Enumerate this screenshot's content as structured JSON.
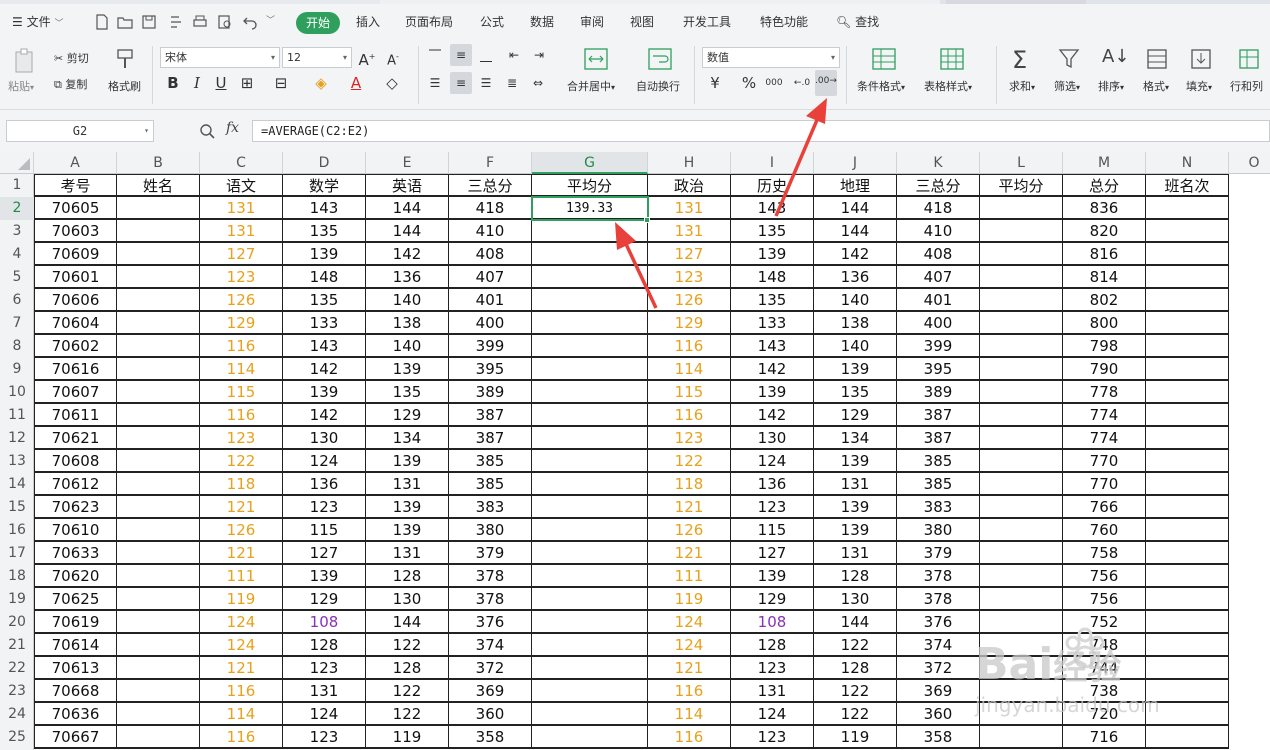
{
  "menubar": {
    "file_label": "文件",
    "tabs": [
      "开始",
      "插入",
      "页面布局",
      "公式",
      "数据",
      "审阅",
      "视图",
      "开发工具",
      "特色功能"
    ],
    "active_tab": "开始",
    "search_label": "查找"
  },
  "ribbon": {
    "paste": "粘贴",
    "cut": "剪切",
    "copy": "复制",
    "format_painter": "格式刷",
    "font_name": "宋体",
    "font_size": "12",
    "bold": "B",
    "italic": "I",
    "underline": "U",
    "merge_center": "合并居中",
    "wrap_text": "自动换行",
    "number_format": "数值",
    "percent": "%",
    "thousands": "000",
    "conditional_format": "条件格式",
    "table_style": "表格样式",
    "sum": "求和",
    "filter": "筛选",
    "sort": "排序",
    "format": "格式",
    "fill": "填充",
    "row_col": "行和列"
  },
  "formula_bar": {
    "name_box": "G2",
    "fx": "fx",
    "formula": "=AVERAGE(C2:E2)"
  },
  "grid": {
    "columns": [
      "A",
      "B",
      "C",
      "D",
      "E",
      "F",
      "G",
      "H",
      "I",
      "J",
      "K",
      "L",
      "M",
      "N",
      "O"
    ],
    "active_column": "G",
    "active_row": "2",
    "row_numbers": [
      "1",
      "2",
      "3",
      "4",
      "5",
      "6",
      "7",
      "8",
      "9",
      "10",
      "11",
      "12",
      "13",
      "14",
      "15",
      "16",
      "17",
      "18",
      "19",
      "20",
      "21",
      "22",
      "23",
      "24",
      "25"
    ],
    "headers": [
      "考号",
      "姓名",
      "语文",
      "数学",
      "英语",
      "三总分",
      "平均分",
      "政治",
      "历史",
      "地理",
      "三总分",
      "平均分",
      "总分",
      "班名次"
    ],
    "rows": [
      [
        "70605",
        "",
        "131",
        "143",
        "144",
        "418",
        "139.33",
        "131",
        "143",
        "144",
        "418",
        "",
        "836",
        ""
      ],
      [
        "70603",
        "",
        "131",
        "135",
        "144",
        "410",
        "",
        "131",
        "135",
        "144",
        "410",
        "",
        "820",
        ""
      ],
      [
        "70609",
        "",
        "127",
        "139",
        "142",
        "408",
        "",
        "127",
        "139",
        "142",
        "408",
        "",
        "816",
        ""
      ],
      [
        "70601",
        "",
        "123",
        "148",
        "136",
        "407",
        "",
        "123",
        "148",
        "136",
        "407",
        "",
        "814",
        ""
      ],
      [
        "70606",
        "",
        "126",
        "135",
        "140",
        "401",
        "",
        "126",
        "135",
        "140",
        "401",
        "",
        "802",
        ""
      ],
      [
        "70604",
        "",
        "129",
        "133",
        "138",
        "400",
        "",
        "129",
        "133",
        "138",
        "400",
        "",
        "800",
        ""
      ],
      [
        "70602",
        "",
        "116",
        "143",
        "140",
        "399",
        "",
        "116",
        "143",
        "140",
        "399",
        "",
        "798",
        ""
      ],
      [
        "70616",
        "",
        "114",
        "142",
        "139",
        "395",
        "",
        "114",
        "142",
        "139",
        "395",
        "",
        "790",
        ""
      ],
      [
        "70607",
        "",
        "115",
        "139",
        "135",
        "389",
        "",
        "115",
        "139",
        "135",
        "389",
        "",
        "778",
        ""
      ],
      [
        "70611",
        "",
        "116",
        "142",
        "129",
        "387",
        "",
        "116",
        "142",
        "129",
        "387",
        "",
        "774",
        ""
      ],
      [
        "70621",
        "",
        "123",
        "130",
        "134",
        "387",
        "",
        "123",
        "130",
        "134",
        "387",
        "",
        "774",
        ""
      ],
      [
        "70608",
        "",
        "122",
        "124",
        "139",
        "385",
        "",
        "122",
        "124",
        "139",
        "385",
        "",
        "770",
        ""
      ],
      [
        "70612",
        "",
        "118",
        "136",
        "131",
        "385",
        "",
        "118",
        "136",
        "131",
        "385",
        "",
        "770",
        ""
      ],
      [
        "70623",
        "",
        "121",
        "123",
        "139",
        "383",
        "",
        "121",
        "123",
        "139",
        "383",
        "",
        "766",
        ""
      ],
      [
        "70610",
        "",
        "126",
        "115",
        "139",
        "380",
        "",
        "126",
        "115",
        "139",
        "380",
        "",
        "760",
        ""
      ],
      [
        "70633",
        "",
        "121",
        "127",
        "131",
        "379",
        "",
        "121",
        "127",
        "131",
        "379",
        "",
        "758",
        ""
      ],
      [
        "70620",
        "",
        "111",
        "139",
        "128",
        "378",
        "",
        "111",
        "139",
        "128",
        "378",
        "",
        "756",
        ""
      ],
      [
        "70625",
        "",
        "119",
        "129",
        "130",
        "378",
        "",
        "119",
        "129",
        "130",
        "378",
        "",
        "756",
        ""
      ],
      [
        "70619",
        "",
        "124",
        "108",
        "144",
        "376",
        "",
        "124",
        "108",
        "144",
        "376",
        "",
        "752",
        ""
      ],
      [
        "70614",
        "",
        "124",
        "128",
        "122",
        "374",
        "",
        "124",
        "128",
        "122",
        "374",
        "",
        "748",
        ""
      ],
      [
        "70613",
        "",
        "121",
        "123",
        "128",
        "372",
        "",
        "121",
        "123",
        "128",
        "372",
        "",
        "744",
        ""
      ],
      [
        "70668",
        "",
        "116",
        "131",
        "122",
        "369",
        "",
        "116",
        "131",
        "122",
        "369",
        "",
        "738",
        ""
      ],
      [
        "70636",
        "",
        "114",
        "124",
        "122",
        "360",
        "",
        "114",
        "124",
        "122",
        "360",
        "",
        "720",
        ""
      ],
      [
        "70667",
        "",
        "116",
        "123",
        "119",
        "358",
        "",
        "116",
        "123",
        "119",
        "358",
        "",
        "716",
        ""
      ]
    ],
    "low_score_color_value": "108"
  },
  "colors": {
    "accent_green": "#2f9f5e",
    "orange_text": "#e6a11d",
    "purple_text": "#8a2fbd",
    "arrow_red": "#e8403a"
  },
  "watermark": {
    "text": "Bai",
    "suffix": "经验",
    "url": "jingyan.baidu.com"
  }
}
